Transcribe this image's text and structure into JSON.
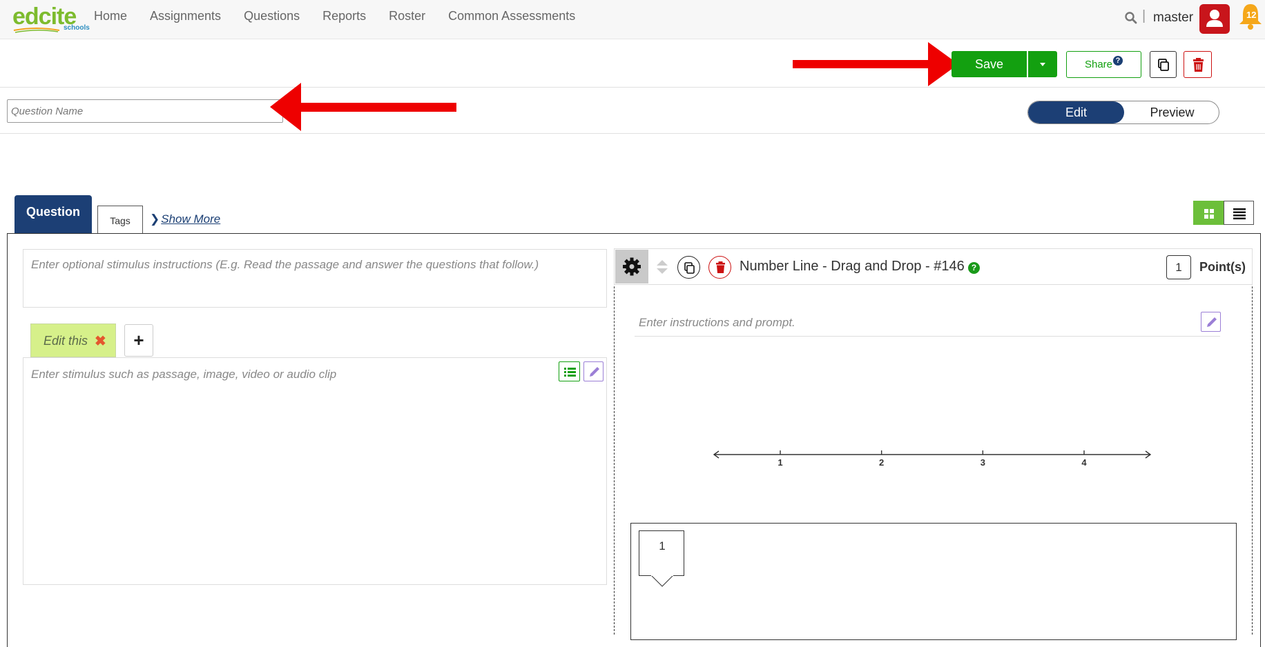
{
  "nav": {
    "logo_text": "edcite",
    "logo_sub": "schools",
    "links": [
      "Home",
      "Assignments",
      "Questions",
      "Reports",
      "Roster",
      "Common Assessments"
    ],
    "separator": "|",
    "username": "master",
    "notifications": "12"
  },
  "toolbar": {
    "save_label": "Save",
    "share_label": "Share",
    "share_help": "?"
  },
  "question_name": {
    "placeholder": "Question Name",
    "value": ""
  },
  "mode_toggle": {
    "edit": "Edit",
    "preview": "Preview",
    "active": "Edit"
  },
  "tabs": {
    "question": "Question",
    "tags": "Tags",
    "show_more": "Show More"
  },
  "stimulus": {
    "instructions_placeholder": "Enter optional stimulus instructions (E.g. Read the passage and answer the questions that follow.)",
    "tab_label": "Edit this",
    "tab_close": "✖",
    "add_label": "+",
    "body_placeholder": "Enter stimulus such as passage, image, video or audio clip"
  },
  "question_item": {
    "title": "Number Line - Drag and Drop - #146",
    "help": "?",
    "points": "1",
    "points_label": "Point(s)",
    "prompt_placeholder": "Enter instructions and prompt.",
    "number_line": {
      "ticks": [
        "1",
        "2",
        "3",
        "4"
      ],
      "values": [
        1,
        2,
        3,
        4
      ]
    },
    "draggable_items": [
      "1"
    ]
  },
  "colors": {
    "brand_navy": "#1c3f75",
    "save_green": "#13a010",
    "delete_red": "#cc1111",
    "annotation_arrow": "#ee0000",
    "tab_lime": "#d6f08a"
  }
}
